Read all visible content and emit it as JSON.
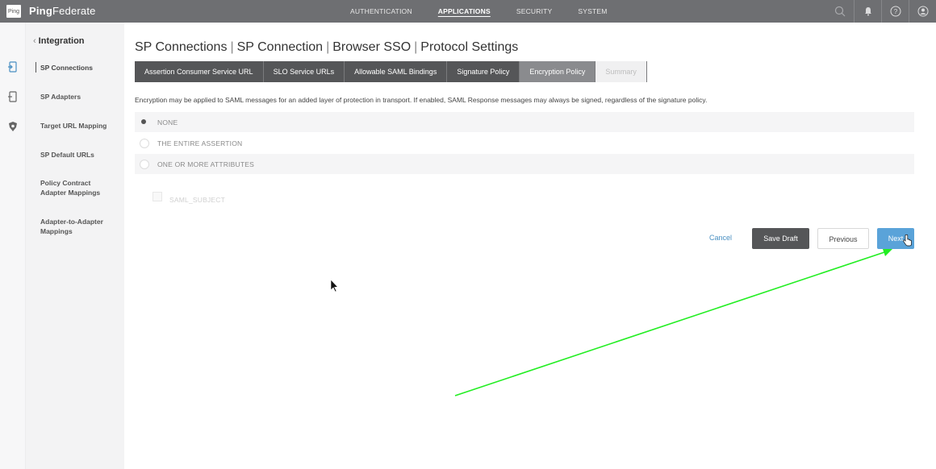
{
  "app": {
    "logo_text": "Ping",
    "name_bold": "Ping",
    "name_rest": "Federate"
  },
  "topnav": {
    "items": [
      "AUTHENTICATION",
      "APPLICATIONS",
      "SECURITY",
      "SYSTEM"
    ],
    "active": "APPLICATIONS"
  },
  "top_icons": [
    "search-icon",
    "bell-icon",
    "help-icon",
    "user-icon"
  ],
  "rail_icons": [
    "application-icon",
    "adapter-icon",
    "security-shield-icon"
  ],
  "sidebar": {
    "back_label": "Integration",
    "items": [
      {
        "label": "SP Connections",
        "active": true
      },
      {
        "label": "SP Adapters"
      },
      {
        "label": "Target URL Mapping"
      },
      {
        "label": "SP Default URLs"
      },
      {
        "label": "Policy Contract\nAdapter Mappings"
      },
      {
        "label": "Adapter-to-Adapter\nMappings"
      }
    ]
  },
  "breadcrumb": [
    "SP Connections",
    "SP Connection",
    "Browser SSO",
    "Protocol Settings"
  ],
  "tabs": [
    {
      "label": "Assertion Consumer Service URL"
    },
    {
      "label": "SLO Service URLs"
    },
    {
      "label": "Allowable SAML Bindings"
    },
    {
      "label": "Signature Policy"
    },
    {
      "label": "Encryption Policy",
      "current": true
    },
    {
      "label": "Summary",
      "disabled": true
    }
  ],
  "description": "Encryption may be applied to SAML messages for an added layer of protection in transport. If enabled, SAML Response messages may always be signed, regardless of the signature policy.",
  "options": [
    {
      "label": "NONE",
      "checked": true
    },
    {
      "label": "THE ENTIRE ASSERTION",
      "checked": false
    },
    {
      "label": "ONE OR MORE ATTRIBUTES",
      "checked": false
    }
  ],
  "attribute": {
    "label": "SAML_SUBJECT"
  },
  "buttons": {
    "cancel": "Cancel",
    "save_draft": "Save Draft",
    "previous": "Previous",
    "next": "Next"
  },
  "colors": {
    "topbar": "#6e6f72",
    "tab_dark": "#555658",
    "tab_current": "#8a8b8e",
    "next_button": "#5aa3d9",
    "link": "#4a90c2",
    "annotation_arrow": "#22ee22"
  }
}
